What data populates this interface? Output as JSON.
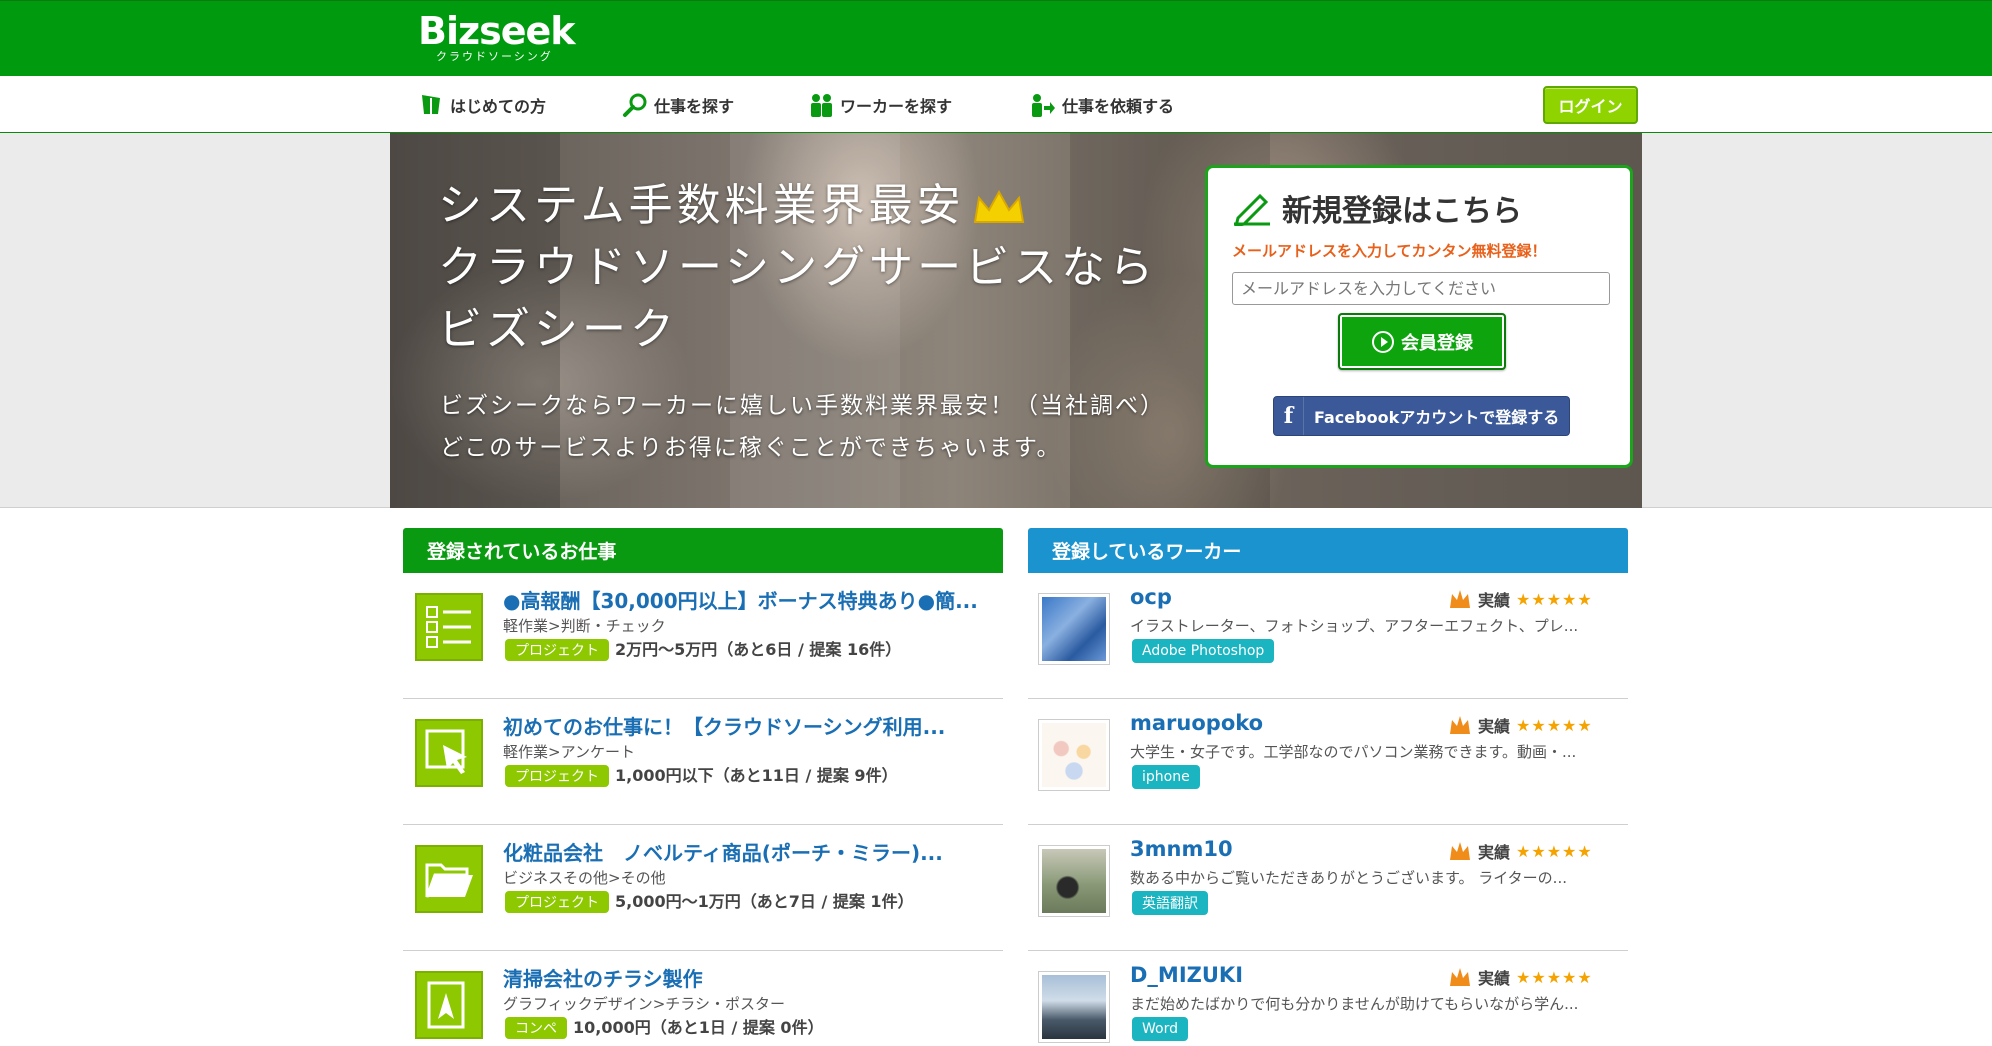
{
  "brand": {
    "logo": "Bizseek",
    "logo_sub": "クラウドソーシング"
  },
  "nav": {
    "items": [
      {
        "label": "はじめての方",
        "icon": "leaf-icon"
      },
      {
        "label": "仕事を探す",
        "icon": "search-icon"
      },
      {
        "label": "ワーカーを探す",
        "icon": "people-icon"
      },
      {
        "label": "仕事を依頼する",
        "icon": "request-icon"
      }
    ],
    "login_label": "ログイン"
  },
  "hero": {
    "title_line1": "システム手数料業界最安",
    "title_line2": "クラウドソーシングサービスなら",
    "title_line3": "ビズシーク",
    "sub_line1": "ビズシークならワーカーに嬉しい手数料業界最安！（当社調べ）",
    "sub_line2": "どこのサービスよりお得に稼ぐことができちゃいます。"
  },
  "signup": {
    "title": "新規登録はこちら",
    "lead": "メールアドレスを入力してカンタン無料登録！",
    "email_placeholder": "メールアドレスを入力してください",
    "submit_label": "会員登録",
    "facebook_label": "Facebookアカウントで登録する"
  },
  "jobs": {
    "heading": "登録されているお仕事",
    "items": [
      {
        "title": "●高報酬【30,000円以上】ボーナス特典あり●簡...",
        "category": "軽作業>判断・チェック",
        "type": "プロジェクト",
        "meta": "2万円～5万円（あと6日 / 提案 16件）",
        "icon": "checklist-icon"
      },
      {
        "title": "初めてのお仕事に！【クラウドソーシング利用...",
        "category": "軽作業>アンケート",
        "type": "プロジェクト",
        "meta": "1,000円以下（あと11日 / 提案 9件）",
        "icon": "cursor-icon"
      },
      {
        "title": "化粧品会社　ノベルティ商品(ポーチ・ミラー)...",
        "category": "ビジネスその他>その他",
        "type": "プロジェクト",
        "meta": "5,000円～1万円（あと7日 / 提案 1件）",
        "icon": "folder-icon"
      },
      {
        "title": "清掃会社のチラシ製作",
        "category": "グラフィックデザイン>チラシ・ポスター",
        "type": "コンペ",
        "meta": "10,000円（あと1日 / 提案 0件）",
        "icon": "design-icon"
      }
    ]
  },
  "workers": {
    "heading": "登録しているワーカー",
    "rating_label": "実績",
    "items": [
      {
        "name": "ocp",
        "desc": "イラストレーター、フォトショップ、アフターエフェクト、プレ...",
        "tag": "Adobe Photoshop",
        "stars": "★★★★★"
      },
      {
        "name": "maruopoko",
        "desc": "大学生・女子です。工学部なのでパソコン業務できます。動画・...",
        "tag": "iphone",
        "stars": "★★★★★"
      },
      {
        "name": "3mnm10",
        "desc": "数ある中からご覧いただきありがとうございます。 ライターの...",
        "tag": "英語翻訳",
        "stars": "★★★★★"
      },
      {
        "name": "D_MIZUKI",
        "desc": "まだ始めたばかりで何も分かりませんが助けてもらいながら学ん...",
        "tag": "Word",
        "stars": "★★★★★"
      }
    ]
  },
  "colors": {
    "brand_green": "#009a0e",
    "lime": "#8dc800",
    "blue_header": "#1a93cf",
    "link": "#1a6fb4",
    "star": "#f5a300"
  }
}
